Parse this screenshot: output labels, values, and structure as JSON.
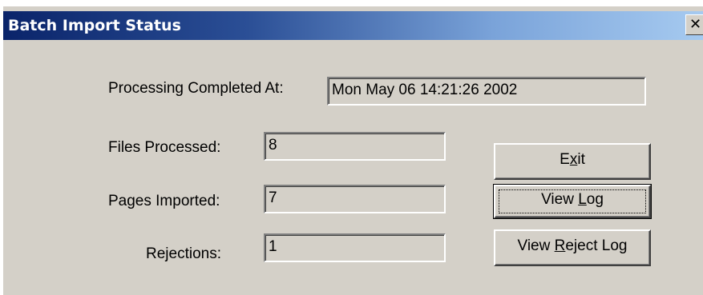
{
  "window": {
    "title": "Batch Import Status"
  },
  "fields": {
    "processing_completed_label": "Processing Completed At:",
    "processing_completed_value": "Mon May 06 14:21:26 2002",
    "files_processed_label": "Files Processed:",
    "files_processed_value": "8",
    "pages_imported_label": "Pages Imported:",
    "pages_imported_value": "7",
    "rejections_label": "Rejections:",
    "rejections_value": "1"
  },
  "buttons": {
    "exit": {
      "pre": "E",
      "accel": "x",
      "post": "it"
    },
    "view_log": {
      "pre": "View ",
      "accel": "L",
      "post": "og"
    },
    "view_reject_log": {
      "pre": "View ",
      "accel": "R",
      "post": "eject Log"
    },
    "close_glyph": "✕"
  }
}
